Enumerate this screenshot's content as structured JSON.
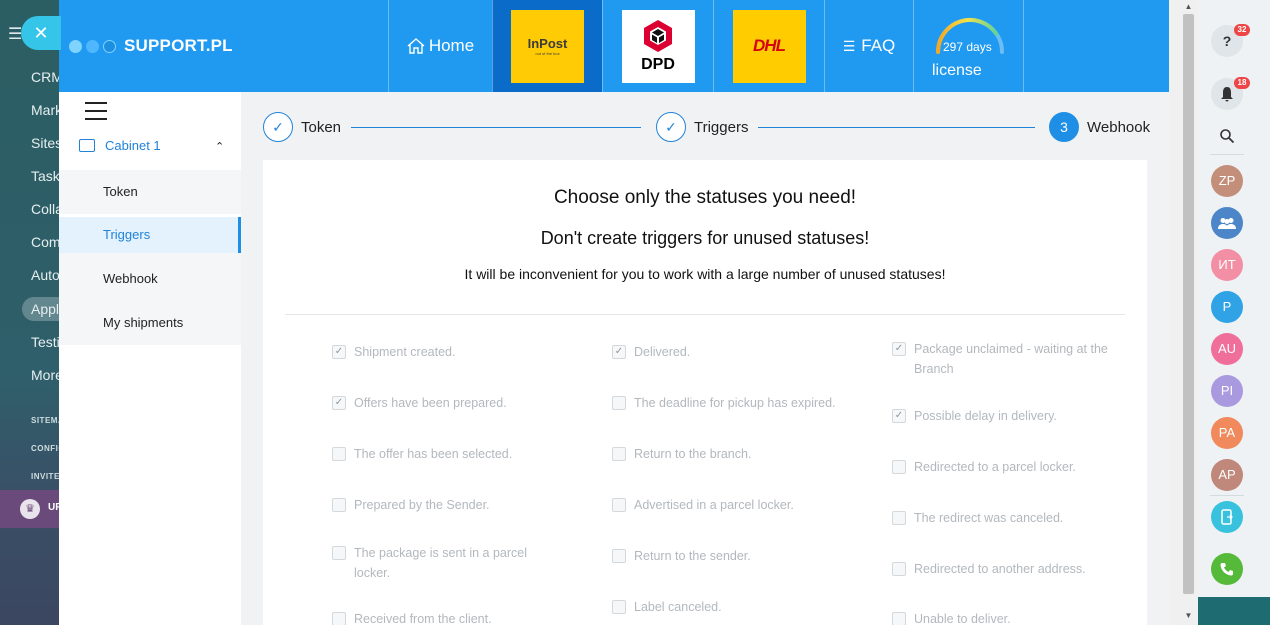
{
  "background_sidebar": {
    "items": [
      "CRM",
      "Marketing",
      "Sites",
      "Tasks",
      "Collaboration",
      "Company",
      "Automation",
      "Applications",
      "Testing",
      "More"
    ],
    "small_items": [
      "SITEMAP",
      "CONFIGURE",
      "INVITE"
    ],
    "banner_label": "UP"
  },
  "header": {
    "brand": "SUPPORT.PL",
    "home_label": "Home",
    "faq_label": "FAQ",
    "carriers": [
      {
        "name": "InPost",
        "sub": "out of the box"
      },
      {
        "name": "DPD"
      },
      {
        "name": "DHL"
      }
    ],
    "license": {
      "days": "297 days",
      "label": "license",
      "fraction": 0.81
    }
  },
  "nav": {
    "cabinet": "Cabinet 1",
    "items": [
      "Token",
      "Triggers",
      "Webhook",
      "My shipments"
    ],
    "active": "Triggers"
  },
  "steps": [
    {
      "label": "Token",
      "state": "done"
    },
    {
      "label": "Triggers",
      "state": "done"
    },
    {
      "label": "Webhook",
      "state": "current",
      "number": "3"
    }
  ],
  "card": {
    "heading1": "Choose only the statuses you need!",
    "heading2": "Don't create triggers for unused statuses!",
    "heading3": "It will be inconvenient for you to work with a large number of unused statuses!"
  },
  "statuses": {
    "col1": [
      {
        "label": "Shipment created.",
        "checked": true
      },
      {
        "label": "Offers have been prepared.",
        "checked": true
      },
      {
        "label": "The offer has been selected.",
        "checked": false
      },
      {
        "label": "Prepared by the Sender.",
        "checked": false
      },
      {
        "label": "The package is sent in a parcel locker.",
        "checked": false
      },
      {
        "label": "Received from the client.",
        "checked": false
      }
    ],
    "col2": [
      {
        "label": "Delivered.",
        "checked": true
      },
      {
        "label": "The deadline for pickup has expired.",
        "checked": false
      },
      {
        "label": "Return to the branch.",
        "checked": false
      },
      {
        "label": "Advertised in a parcel locker.",
        "checked": false
      },
      {
        "label": "Return to the sender.",
        "checked": false
      },
      {
        "label": "Label canceled.",
        "checked": false
      }
    ],
    "col3": [
      {
        "label": "Package unclaimed - waiting at the Branch",
        "checked": true
      },
      {
        "label": "Possible delay in delivery.",
        "checked": true
      },
      {
        "label": "Redirected to a parcel locker.",
        "checked": false
      },
      {
        "label": "The redirect was canceled.",
        "checked": false
      },
      {
        "label": "Redirected to another address.",
        "checked": false
      },
      {
        "label": "Unable to deliver.",
        "checked": false
      }
    ]
  },
  "right_rail": {
    "help_badge": "32",
    "notif_badge": "18",
    "avatars": [
      {
        "initials": "ZP",
        "color": "#c38f7a"
      },
      {
        "initials": "",
        "color": "#4c86c8"
      },
      {
        "initials": "ИТ",
        "color": "#f28fa5"
      },
      {
        "initials": "P",
        "color": "#2fa3e6"
      },
      {
        "initials": "AU",
        "color": "#ef6f9a"
      },
      {
        "initials": "PI",
        "color": "#a99ae0"
      },
      {
        "initials": "PA",
        "color": "#f08a5d"
      },
      {
        "initials": "AP",
        "color": "#c0887a"
      }
    ]
  },
  "colors": {
    "header": "#1f9af0",
    "accent": "#2183d8",
    "call": "#55b93a",
    "device": "#39c2dd"
  }
}
